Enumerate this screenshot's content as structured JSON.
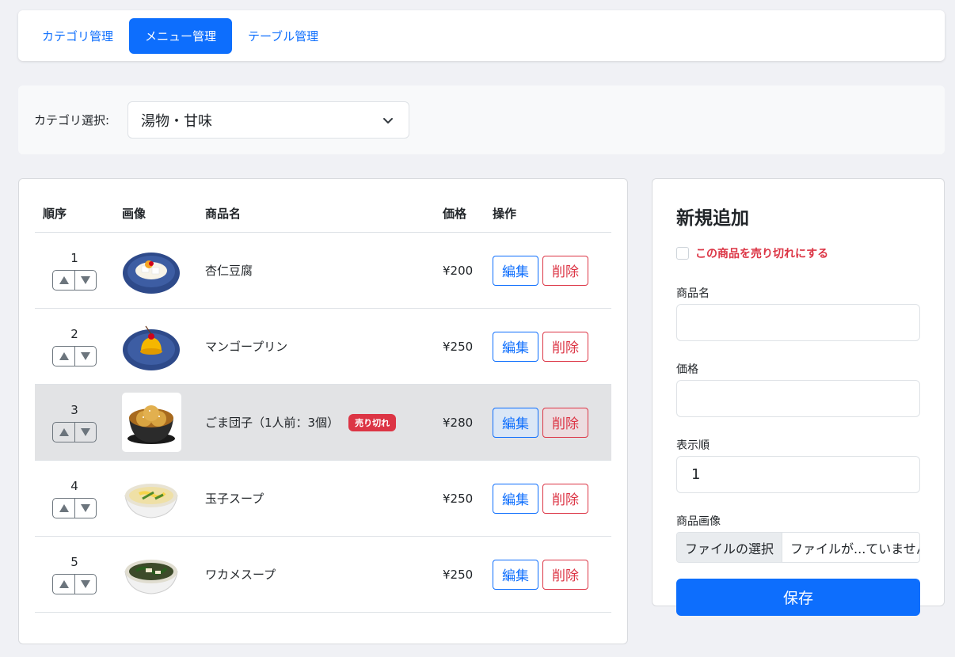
{
  "nav": {
    "tabs": [
      {
        "label": "カテゴリ管理",
        "active": false
      },
      {
        "label": "メニュー管理",
        "active": true
      },
      {
        "label": "テーブル管理",
        "active": false
      }
    ]
  },
  "category": {
    "label": "カテゴリ選択:",
    "selected": "湯物・甘味"
  },
  "table": {
    "headers": {
      "order": "順序",
      "image": "画像",
      "name": "商品名",
      "price": "価格",
      "ops": "操作"
    },
    "rows": [
      {
        "order": "1",
        "name": "杏仁豆腐",
        "price": "¥200",
        "soldout": false,
        "edit": "編集",
        "delete": "削除",
        "image": "almond-tofu-image"
      },
      {
        "order": "2",
        "name": "マンゴープリン",
        "price": "¥250",
        "soldout": false,
        "edit": "編集",
        "delete": "削除",
        "image": "mango-pudding-image"
      },
      {
        "order": "3",
        "name": "ごま団子（1人前：3個）",
        "price": "¥280",
        "soldout": true,
        "badge": "売り切れ",
        "edit": "編集",
        "delete": "削除",
        "image": "sesame-balls-image"
      },
      {
        "order": "4",
        "name": "玉子スープ",
        "price": "¥250",
        "soldout": false,
        "edit": "編集",
        "delete": "削除",
        "image": "egg-soup-image"
      },
      {
        "order": "5",
        "name": "ワカメスープ",
        "price": "¥250",
        "soldout": false,
        "edit": "編集",
        "delete": "削除",
        "image": "wakame-soup-image"
      }
    ]
  },
  "form": {
    "title": "新規追加",
    "soldout_label": "この商品を売り切れにする",
    "name_label": "商品名",
    "name_value": "",
    "price_label": "価格",
    "price_value": "",
    "order_label": "表示順",
    "order_value": "1",
    "image_label": "商品画像",
    "file_button": "ファイルの選択",
    "file_name": "ファイルが...ていません",
    "save_label": "保存"
  },
  "colors": {
    "primary": "#0d6efd",
    "danger": "#dc3545",
    "soldout_row": "#e2e3e5"
  }
}
